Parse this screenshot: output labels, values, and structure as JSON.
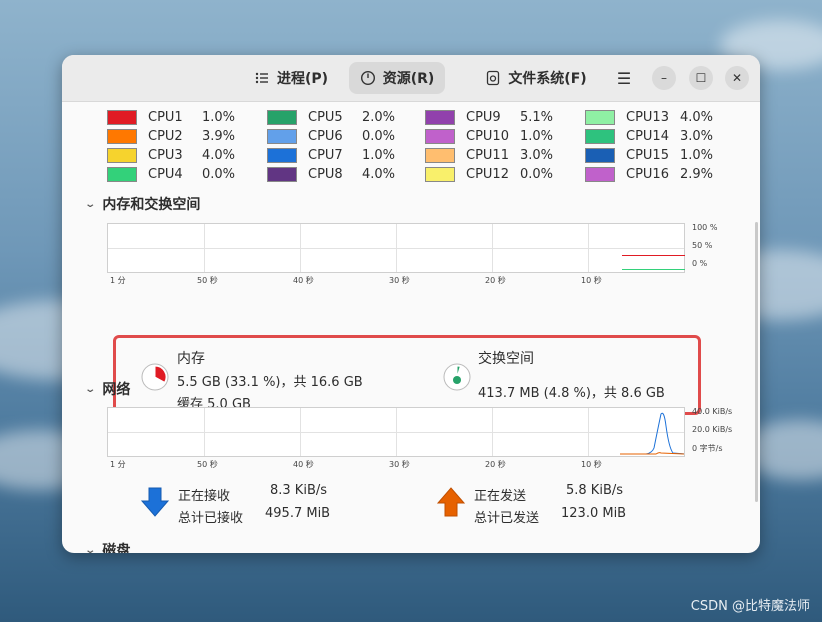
{
  "header": {
    "tabs": [
      {
        "label": "进程(P)",
        "icon": "list-icon",
        "active": false
      },
      {
        "label": "资源(R)",
        "icon": "gauge-icon",
        "active": true
      },
      {
        "label": "文件系统(F)",
        "icon": "disk-icon",
        "active": false
      }
    ],
    "menu_glyph": "☰",
    "minimize_glyph": "–",
    "maximize_glyph": "☐",
    "close_glyph": "✕"
  },
  "cpu": {
    "items": [
      {
        "name": "CPU1",
        "value": "1.0%",
        "color": "#e01b24"
      },
      {
        "name": "CPU2",
        "value": "3.9%",
        "color": "#ff7800"
      },
      {
        "name": "CPU3",
        "value": "4.0%",
        "color": "#f6d32d"
      },
      {
        "name": "CPU4",
        "value": "0.0%",
        "color": "#33d17a"
      },
      {
        "name": "CPU5",
        "value": "2.0%",
        "color": "#26a269"
      },
      {
        "name": "CPU6",
        "value": "0.0%",
        "color": "#62a0ea"
      },
      {
        "name": "CPU7",
        "value": "1.0%",
        "color": "#1c71d8"
      },
      {
        "name": "CPU8",
        "value": "4.0%",
        "color": "#613583"
      },
      {
        "name": "CPU9",
        "value": "5.1%",
        "color": "#9141ac"
      },
      {
        "name": "CPU10",
        "value": "1.0%",
        "color": "#c061cb"
      },
      {
        "name": "CPU11",
        "value": "3.0%",
        "color": "#ffbe6f"
      },
      {
        "name": "CPU12",
        "value": "0.0%",
        "color": "#f9f06b"
      },
      {
        "name": "CPU13",
        "value": "4.0%",
        "color": "#8ff0a4"
      },
      {
        "name": "CPU14",
        "value": "3.0%",
        "color": "#2ec27e"
      },
      {
        "name": "CPU15",
        "value": "1.0%",
        "color": "#1a5fb4"
      },
      {
        "name": "CPU16",
        "value": "2.9%",
        "color": "#c061cb"
      }
    ]
  },
  "memory": {
    "section_title": "内存和交换空间",
    "x_ticks": [
      "1 分",
      "50 秒",
      "40 秒",
      "30 秒",
      "20 秒",
      "10 秒"
    ],
    "y_ticks": [
      "100 %",
      "50 %",
      "0 %"
    ],
    "mem_label": "内存",
    "mem_usage": "5.5 GB (33.1 %)，共 16.6 GB",
    "mem_cache": "缓存 5.0 GB",
    "mem_fraction": 0.331,
    "mem_color": "#e01b24",
    "swap_label": "交换空间",
    "swap_usage": "413.7 MB (4.8 %)，共 8.6 GB",
    "swap_fraction": 0.048,
    "swap_color": "#26a269"
  },
  "network": {
    "section_title": "网络",
    "x_ticks": [
      "1 分",
      "50 秒",
      "40 秒",
      "30 秒",
      "20 秒",
      "10 秒"
    ],
    "y_ticks": [
      "40.0 KiB/s",
      "20.0 KiB/s",
      "0 字节/s"
    ],
    "recv_label": "正在接收",
    "recv_value": "8.3 KiB/s",
    "recv_total_label": "总计已接收",
    "recv_total_value": "495.7 MiB",
    "send_label": "正在发送",
    "send_value": "5.8 KiB/s",
    "send_total_label": "总计已发送",
    "send_total_value": "123.0 MiB",
    "recv_color": "#1c71d8",
    "send_color": "#e66100"
  },
  "disk": {
    "section_title": "磁盘"
  },
  "watermark": "CSDN @比特魔法师"
}
